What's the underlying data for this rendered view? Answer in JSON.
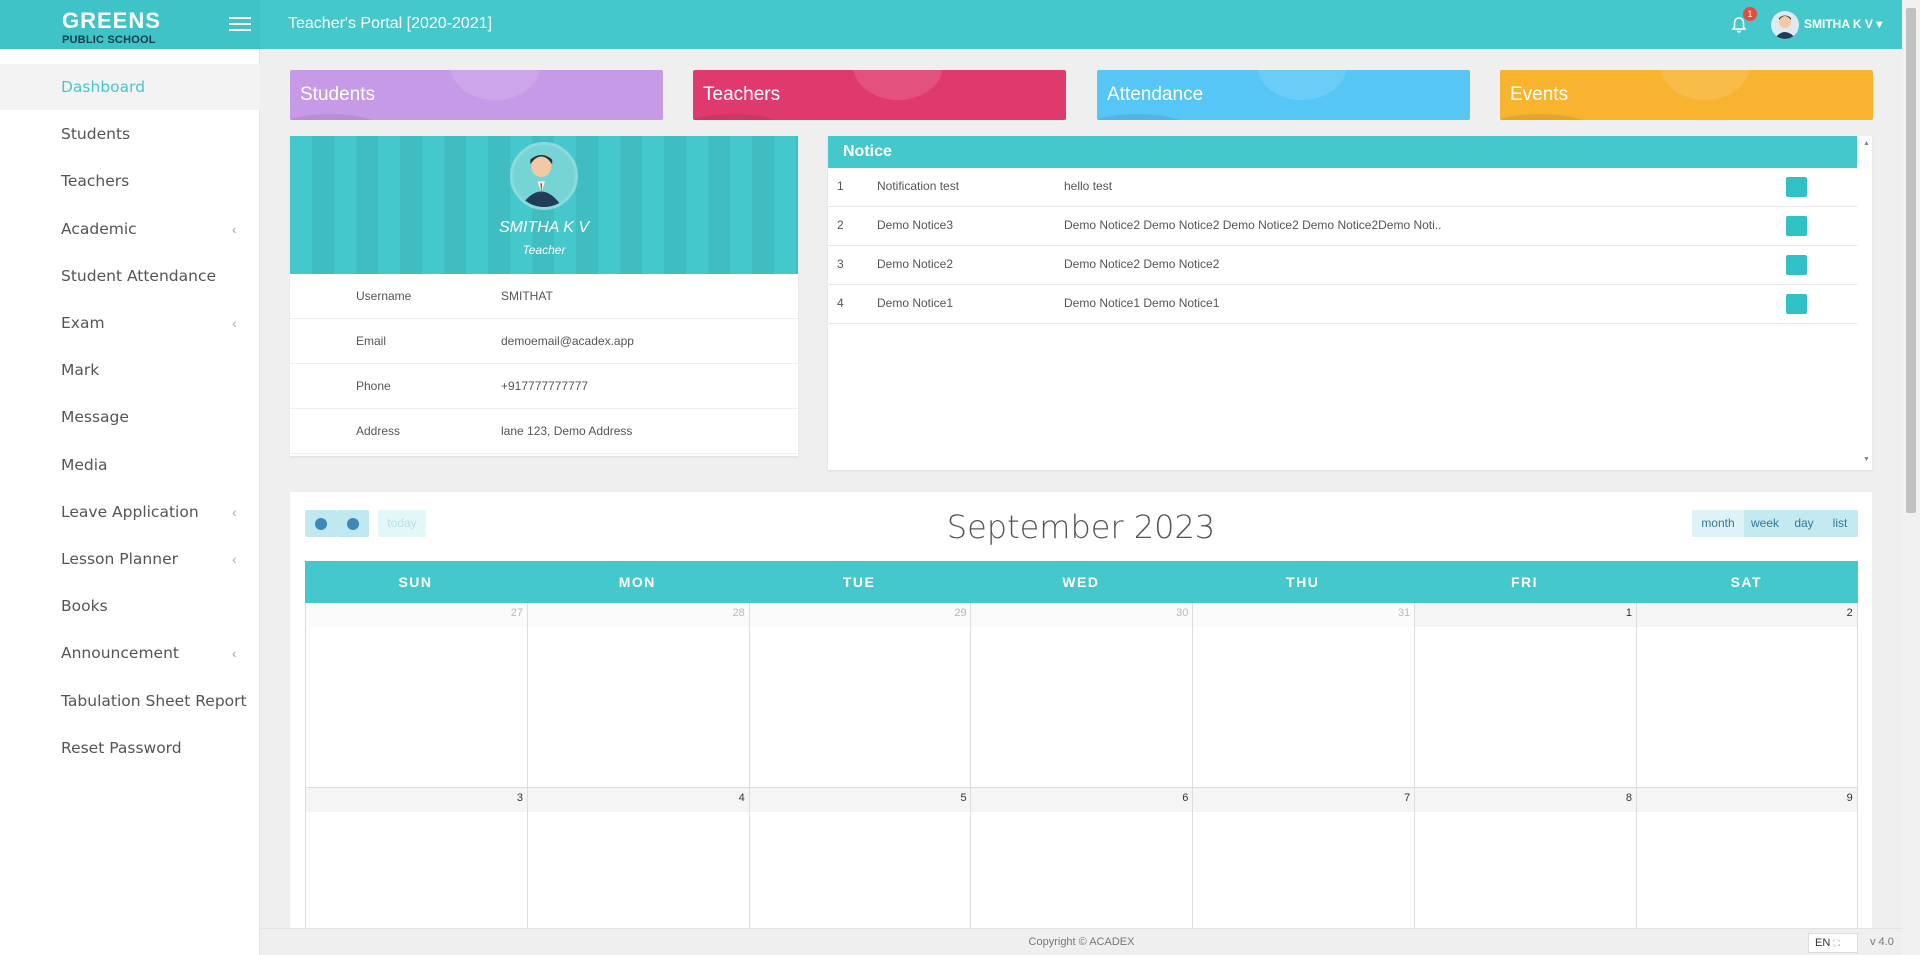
{
  "brand": {
    "line1": "GREENS",
    "line2": "PUBLIC SCHOOL"
  },
  "header": {
    "title": "Teacher's Portal [2020-2021]",
    "notification_count": "1",
    "user_name": "SMITHA K V"
  },
  "sidebar": {
    "items": [
      {
        "label": "Dashboard",
        "icon": "home-icon",
        "color": "#e0416e",
        "active": true
      },
      {
        "label": "Students",
        "icon": "graduation-cap-icon",
        "color": "#e07a2a"
      },
      {
        "label": "Teachers",
        "icon": "users-icon",
        "color": "#5b4fc7"
      },
      {
        "label": "Academic",
        "icon": "ladder-icon",
        "color": "#c0503b",
        "submenu": true
      },
      {
        "label": "Student Attendance",
        "icon": "attendance-icon",
        "color": "#5b4d3d"
      },
      {
        "label": "Exam",
        "icon": "exam-icon",
        "color": "#2fb3b8",
        "submenu": true
      },
      {
        "label": "Mark",
        "icon": "flask-icon",
        "color": "#5b5b5b"
      },
      {
        "label": "Message",
        "icon": "envelope-icon",
        "color": "#9ec73d"
      },
      {
        "label": "Media",
        "icon": "film-icon",
        "color": "#d9453b"
      },
      {
        "label": "Leave Application",
        "icon": "document-icon",
        "color": "#2fb3b8",
        "submenu": true
      },
      {
        "label": "Lesson Planner",
        "icon": "calendar-icon",
        "color": "#c03bb0",
        "submenu": true
      },
      {
        "label": "Books",
        "icon": "books-icon",
        "color": "#444444"
      },
      {
        "label": "Announcement",
        "icon": "megaphone-icon",
        "color": "#d9453b",
        "submenu": true
      },
      {
        "label": "Tabulation Sheet Report",
        "icon": "report-search-icon",
        "color": "#444444"
      },
      {
        "label": "Reset Password",
        "icon": "lock-reset-icon",
        "color": "#2fb3b8"
      }
    ]
  },
  "stats": [
    {
      "label": "Students",
      "color": "#c79ae8",
      "icon": "graduate-icon"
    },
    {
      "label": "Teachers",
      "color": "#e0396e",
      "icon": "teacher-icon"
    },
    {
      "label": "Attendance",
      "color": "#56c6f7",
      "icon": "person-icon"
    },
    {
      "label": "Events",
      "color": "#f8b32f",
      "icon": "calendar-check-icon"
    }
  ],
  "profile": {
    "name": "SMITHA K V",
    "role": "Teacher",
    "fields": [
      {
        "key": "Username",
        "value": "SMITHAT",
        "icon": "user-icon"
      },
      {
        "key": "Email",
        "value": "demoemail@acadex.app",
        "icon": "envelope-icon"
      },
      {
        "key": "Phone",
        "value": "+917777777777",
        "icon": "phone-icon"
      },
      {
        "key": "Address",
        "value": "lane 123, Demo Address",
        "icon": "globe-icon"
      }
    ]
  },
  "notice": {
    "title": "Notice",
    "rows": [
      {
        "no": "1",
        "title": "Notification test",
        "body": "hello test"
      },
      {
        "no": "2",
        "title": "Demo Notice3",
        "body": "Demo Notice2 Demo Notice2 Demo Notice2 Demo Notice2Demo Noti.."
      },
      {
        "no": "3",
        "title": "Demo Notice2",
        "body": "Demo Notice2 Demo Notice2"
      },
      {
        "no": "4",
        "title": "Demo Notice1",
        "body": "Demo Notice1 Demo Notice1"
      }
    ]
  },
  "calendar": {
    "title": "September 2023",
    "today_label": "today",
    "views": [
      "month",
      "week",
      "day",
      "list"
    ],
    "active_view": "month",
    "days_of_week": [
      "SUN",
      "MON",
      "TUE",
      "WED",
      "THU",
      "FRI",
      "SAT"
    ],
    "weeks": [
      [
        {
          "d": "27",
          "other": true
        },
        {
          "d": "28",
          "other": true
        },
        {
          "d": "29",
          "other": true
        },
        {
          "d": "30",
          "other": true
        },
        {
          "d": "31",
          "other": true
        },
        {
          "d": "1"
        },
        {
          "d": "2"
        }
      ],
      [
        {
          "d": "3"
        },
        {
          "d": "4"
        },
        {
          "d": "5"
        },
        {
          "d": "6"
        },
        {
          "d": "7"
        },
        {
          "d": "8"
        },
        {
          "d": "9"
        }
      ]
    ]
  },
  "footer": {
    "copyright": "Copyright © ACADEX",
    "language": "EN",
    "version": "v 4.0"
  }
}
